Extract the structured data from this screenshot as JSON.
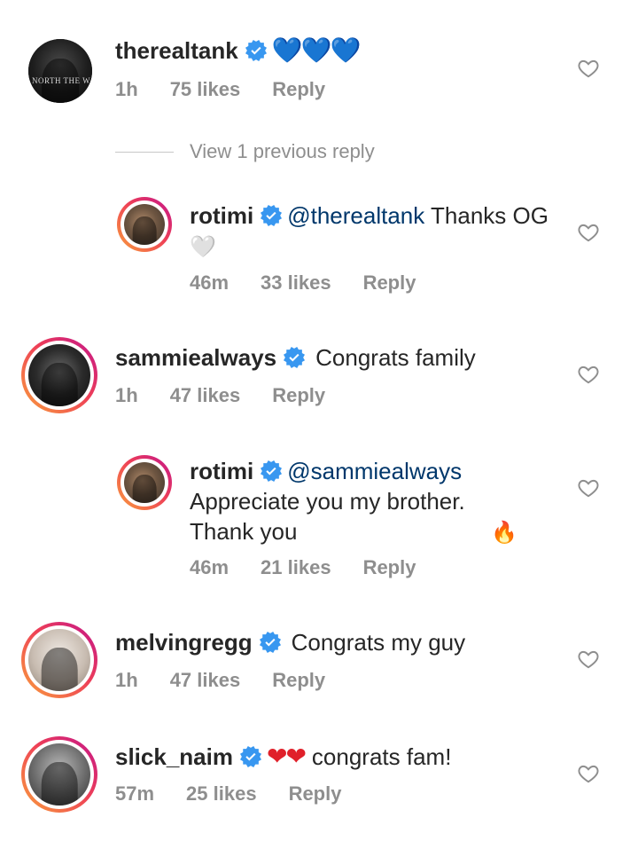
{
  "comments": [
    {
      "username": "therealtank",
      "text_emoji": "💙💙💙",
      "time": "1h",
      "likes": "75 likes",
      "reply": "Reply",
      "avatar_text": "NORTH THE WA",
      "story_ring": false
    },
    {
      "username": "rotimi",
      "mention": "@therealtank",
      "text": " Thanks OG",
      "emoji": "🤍",
      "time": "46m",
      "likes": "33 likes",
      "reply": "Reply",
      "story_ring": true,
      "is_reply": true
    },
    {
      "username": "sammiealways",
      "text": "Congrats family",
      "time": "1h",
      "likes": "47 likes",
      "reply": "Reply",
      "story_ring": true
    },
    {
      "username": "rotimi",
      "mention": "@sammiealways",
      "text": "Appreciate you my brother. Thank you",
      "emoji": "🔥",
      "time": "46m",
      "likes": "21 likes",
      "reply": "Reply",
      "story_ring": true,
      "is_reply": true
    },
    {
      "username": "melvingregg",
      "text": "Congrats my guy",
      "time": "1h",
      "likes": "47 likes",
      "reply": "Reply",
      "story_ring": true
    },
    {
      "username": "slick_naim",
      "text_emoji": "❤❤",
      "text": "congrats fam!",
      "time": "57m",
      "likes": "25 likes",
      "reply": "Reply",
      "story_ring": true
    }
  ],
  "view_previous": "View 1 previous reply",
  "colors": {
    "verified": "#3897f0",
    "mention": "#00376b",
    "meta": "#8e8e8e",
    "text": "#262626"
  },
  "icons": {
    "verified": "verified-badge-icon",
    "like": "heart-outline-icon"
  }
}
